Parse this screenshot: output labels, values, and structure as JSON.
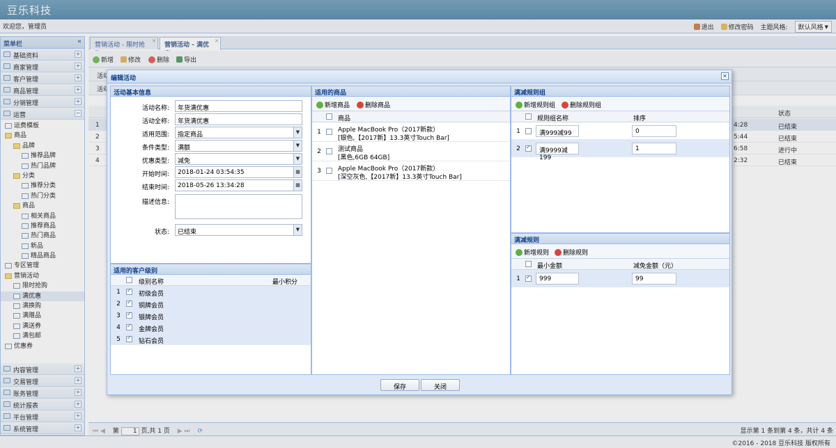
{
  "app": {
    "title": "豆乐科技"
  },
  "header": {
    "welcome": "欢迎您，管理员",
    "logout": "退出",
    "change_password": "修改密码",
    "theme_label": "主题风格:",
    "theme_value": "默认风格"
  },
  "sidebar": {
    "title": "菜单栏",
    "top_groups": [
      "基础资料",
      "商家管理",
      "客户管理",
      "商品管理",
      "分销管理",
      "运营"
    ],
    "tree": [
      {
        "label": "运费模板",
        "level": 0,
        "type": "doc"
      },
      {
        "label": "商品",
        "level": 0,
        "type": "folder"
      },
      {
        "label": "品牌",
        "level": 1,
        "type": "folder"
      },
      {
        "label": "推荐品牌",
        "level": 2,
        "type": "doc"
      },
      {
        "label": "热门品牌",
        "level": 2,
        "type": "doc"
      },
      {
        "label": "分类",
        "level": 1,
        "type": "folder"
      },
      {
        "label": "推荐分类",
        "level": 2,
        "type": "doc"
      },
      {
        "label": "热门分类",
        "level": 2,
        "type": "doc"
      },
      {
        "label": "商品",
        "level": 1,
        "type": "folder"
      },
      {
        "label": "相关商品",
        "level": 2,
        "type": "doc"
      },
      {
        "label": "推荐商品",
        "level": 2,
        "type": "doc"
      },
      {
        "label": "热门商品",
        "level": 2,
        "type": "doc"
      },
      {
        "label": "新品",
        "level": 2,
        "type": "doc"
      },
      {
        "label": "精品商品",
        "level": 2,
        "type": "doc"
      },
      {
        "label": "专区管理",
        "level": 0,
        "type": "doc"
      },
      {
        "label": "营销活动",
        "level": 0,
        "type": "folder"
      },
      {
        "label": "限时抢购",
        "level": 1,
        "type": "doc"
      },
      {
        "label": "满优惠",
        "level": 1,
        "type": "doc",
        "selected": true
      },
      {
        "label": "满换购",
        "level": 1,
        "type": "doc"
      },
      {
        "label": "满赠品",
        "level": 1,
        "type": "doc"
      },
      {
        "label": "满送券",
        "level": 1,
        "type": "doc"
      },
      {
        "label": "满包邮",
        "level": 1,
        "type": "doc"
      },
      {
        "label": "优惠券",
        "level": 0,
        "type": "doc"
      }
    ],
    "bottom_groups": [
      "内容管理",
      "交易管理",
      "账务管理",
      "统计报表",
      "平台管理",
      "系统管理"
    ]
  },
  "tabs": [
    {
      "label": "营销活动 - 限时抢购",
      "active": false
    },
    {
      "label": "营销活动 - 满优惠",
      "active": true
    }
  ],
  "toolbar": {
    "add": "新增",
    "edit": "修改",
    "delete": "删除",
    "export": "导出"
  },
  "bg_grid": {
    "partial_labels": [
      "活动",
      "活动"
    ],
    "status_header": "状态",
    "rows": [
      {
        "num": "1",
        "time": "4:28",
        "status": "已结束"
      },
      {
        "num": "2",
        "time": "5:44",
        "status": "已结束"
      },
      {
        "num": "3",
        "time": "6:58",
        "status": "进行中"
      },
      {
        "num": "4",
        "time": "2:32",
        "status": "已结束"
      }
    ]
  },
  "pager": {
    "page_label": "第",
    "page_value": "1",
    "of_label": "页,共 1 页",
    "summary": "显示第 1 条到第 4 条，共计 4 条"
  },
  "footer": {
    "text": "©2016 - 2018  豆乐科技  版权所有"
  },
  "dialog": {
    "title": "编辑活动",
    "basic": {
      "heading": "活动基本信息",
      "fields": [
        {
          "label": "活动名称:",
          "value": "年货满优惠",
          "dropdown": false
        },
        {
          "label": "活动全称:",
          "value": "年货满优惠",
          "dropdown": false
        },
        {
          "label": "适用范围:",
          "value": "指定商品",
          "dropdown": true
        },
        {
          "label": "条件类型:",
          "value": "满额",
          "dropdown": true
        },
        {
          "label": "优惠类型:",
          "value": "减免",
          "dropdown": true
        },
        {
          "label": "开始时间:",
          "value": "2018-01-24 03:54:35",
          "dropdown": false
        },
        {
          "label": "结束时间:",
          "value": "2018-05-26 13:34:28",
          "dropdown": false
        }
      ],
      "desc_label": "描述信息:",
      "status_label": "状态:",
      "status_value": "已结束"
    },
    "customer_levels": {
      "heading": "适用的客户级别",
      "col_name": "级别名称",
      "col_points": "最小积分",
      "rows": [
        "初级会员",
        "铜牌会员",
        "银牌会员",
        "金牌会员",
        "钻石会员"
      ]
    },
    "products": {
      "heading": "适用的商品",
      "add": "新增商品",
      "delete": "删除商品",
      "col": "商品",
      "rows": [
        {
          "line1": "Apple MacBook Pro（2017新款）",
          "line2": "[银色,【2017新】13.3英寸Touch Bar]"
        },
        {
          "line1": "测试商品",
          "line2": "[黑色,6GB 64GB]"
        },
        {
          "line1": "Apple MacBook Pro（2017新款）",
          "line2": "[深空灰色,【2017新】13.3英寸Touch Bar]"
        }
      ]
    },
    "rule_groups": {
      "heading": "满减规则组",
      "add": "新增规则组",
      "delete": "删除规则组",
      "col_name": "规则组名称",
      "col_order": "排序",
      "rows": [
        {
          "name": "满999减99",
          "order": "0",
          "checked": false
        },
        {
          "name": "满9999减199",
          "order": "1",
          "checked": true
        }
      ]
    },
    "rules": {
      "heading": "满减规则",
      "add": "新增规则",
      "delete": "删除规则",
      "col_min": "最小金额",
      "col_amount": "减免金额（元）",
      "rows": [
        {
          "min": "999",
          "amount": "99"
        }
      ]
    },
    "save": "保存",
    "close": "关闭"
  }
}
